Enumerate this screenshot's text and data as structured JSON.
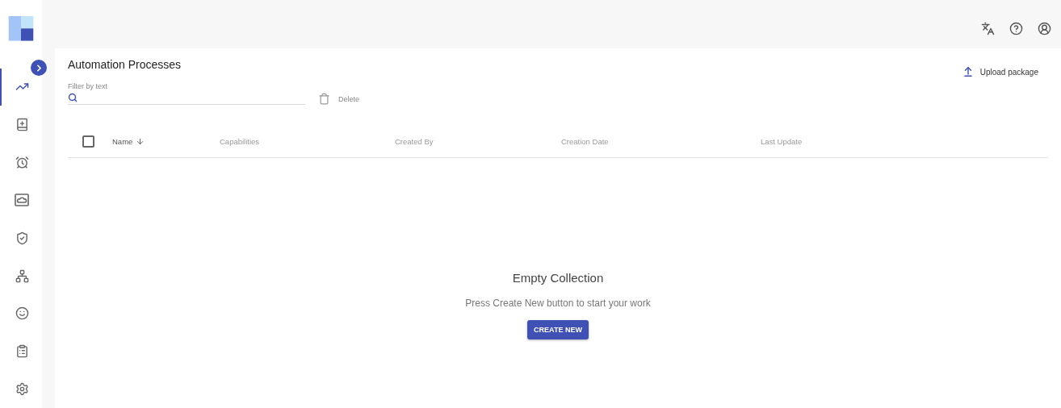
{
  "sidebar": {
    "items": [
      {
        "selected": true
      },
      {
        "selected": false
      },
      {
        "selected": false
      },
      {
        "selected": false
      },
      {
        "selected": false
      },
      {
        "selected": false
      },
      {
        "selected": false
      },
      {
        "selected": false
      },
      {
        "selected": false
      }
    ]
  },
  "page": {
    "title": "Automation Processes",
    "upload_label": "Upload package"
  },
  "filter": {
    "label": "Filter by text",
    "delete_label": "Delete"
  },
  "table": {
    "select_all_checked": false,
    "columns": [
      {
        "label": "Name",
        "sorted": true
      },
      {
        "label": "Capabilities",
        "sorted": false
      },
      {
        "label": "Created By",
        "sorted": false
      },
      {
        "label": "Creation Date",
        "sorted": false
      },
      {
        "label": "Last Update",
        "sorted": false
      }
    ]
  },
  "empty": {
    "title": "Empty Collection",
    "message": "Press Create New button to start your work",
    "button": "CREATE NEW"
  }
}
